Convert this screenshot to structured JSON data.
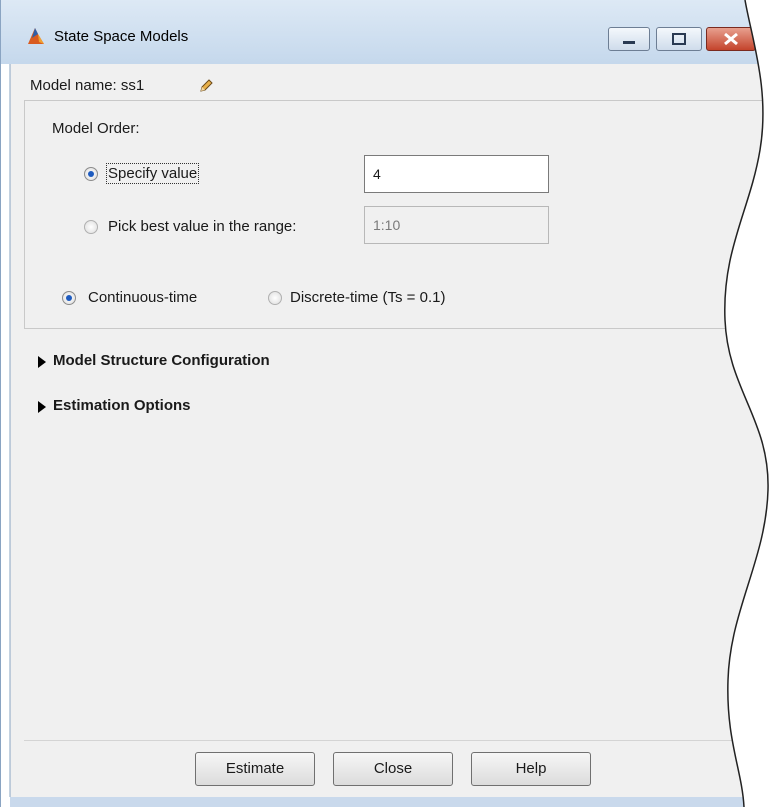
{
  "window": {
    "title": "State Space Models",
    "controls": [
      "minimize-icon",
      "maximize-icon",
      "close-icon"
    ]
  },
  "model_name": {
    "label": "Model name: ss1",
    "edit_icon": "pencil-icon"
  },
  "model_order": {
    "heading": "Model Order:",
    "specify_label": "Specify value",
    "specify_value": "4",
    "range_label": "Pick best value in the range:",
    "range_value": "1:10",
    "selected": "specify"
  },
  "time_domain": {
    "continuous_label": "Continuous-time",
    "discrete_label": "Discrete-time (Ts = 0.1)",
    "selected": "continuous"
  },
  "sections": {
    "structure": "Model Structure Configuration",
    "estimation": "Estimation Options"
  },
  "buttons": {
    "estimate": "Estimate",
    "close": "Close",
    "help": "Help"
  }
}
